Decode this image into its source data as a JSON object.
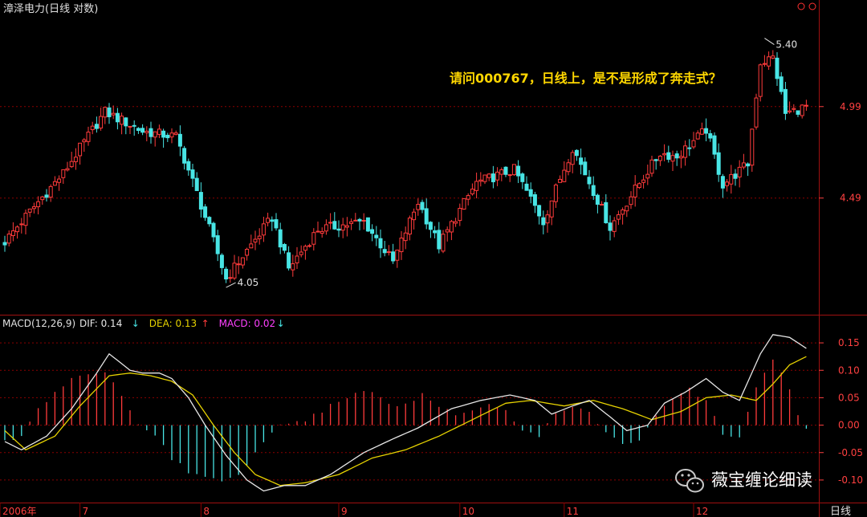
{
  "header": {
    "title": "漳泽电力(日线 对数)",
    "period_label": "日线"
  },
  "annotation": "请问000767，日线上，是不是形成了奔走式？",
  "watermark": {
    "text": "薇宝缠论细读",
    "icon": "wechat-icon"
  },
  "colors": {
    "up": "#ff3b3b",
    "down": "#48e5e5",
    "grid": "#8b0000",
    "axis_text": "#ff4040",
    "dif": "#e6e6e6",
    "dea": "#e6d200",
    "macd": "#ff40ff",
    "annotation": "#ffd700"
  },
  "chart_data": [
    {
      "type": "candlestick",
      "title": "漳泽电力(日线 对数)",
      "scale": "log",
      "y_ticks": [
        "4.99",
        "4.49"
      ],
      "y_tick_values": [
        4.99,
        4.49
      ],
      "ylim": [
        3.95,
        5.55
      ],
      "x_ticks": [
        {
          "label": "2006年",
          "index": 0
        },
        {
          "label": "7",
          "index": 18
        },
        {
          "label": "8",
          "index": 47
        },
        {
          "label": "9",
          "index": 80
        },
        {
          "label": "10",
          "index": 109
        },
        {
          "label": "11",
          "index": 134
        },
        {
          "label": "12",
          "index": 165
        }
      ],
      "annotations": [
        {
          "text": "5.40",
          "value": 5.4,
          "index": 182,
          "kind": "high"
        },
        {
          "text": "4.05",
          "value": 4.05,
          "index": 53,
          "kind": "low"
        }
      ],
      "key_points": [
        {
          "index": 0,
          "value": 4.27
        },
        {
          "index": 14,
          "value": 4.62
        },
        {
          "index": 24,
          "value": 4.96
        },
        {
          "index": 33,
          "value": 4.85
        },
        {
          "index": 41,
          "value": 4.82
        },
        {
          "index": 53,
          "value": 4.09
        },
        {
          "index": 64,
          "value": 4.39
        },
        {
          "index": 68,
          "value": 4.14
        },
        {
          "index": 75,
          "value": 4.33
        },
        {
          "index": 86,
          "value": 4.37
        },
        {
          "index": 93,
          "value": 4.17
        },
        {
          "index": 99,
          "value": 4.47
        },
        {
          "index": 104,
          "value": 4.25
        },
        {
          "index": 113,
          "value": 4.57
        },
        {
          "index": 122,
          "value": 4.64
        },
        {
          "index": 129,
          "value": 4.37
        },
        {
          "index": 136,
          "value": 4.76
        },
        {
          "index": 145,
          "value": 4.34
        },
        {
          "index": 157,
          "value": 4.73
        },
        {
          "index": 161,
          "value": 4.71
        },
        {
          "index": 168,
          "value": 4.86
        },
        {
          "index": 172,
          "value": 4.56
        },
        {
          "index": 178,
          "value": 4.67
        },
        {
          "index": 181,
          "value": 5.25
        },
        {
          "index": 184,
          "value": 5.28
        },
        {
          "index": 187,
          "value": 4.95
        },
        {
          "index": 192,
          "value": 4.99
        }
      ]
    },
    {
      "type": "line",
      "title": "MACD(12,26,9)",
      "legend": [
        {
          "label": "DIF:",
          "value": "0.14",
          "arrow": "↓",
          "color": "#e6e6e6"
        },
        {
          "label": "DEA:",
          "value": "0.13",
          "arrow": "↑",
          "color": "#e6d200"
        },
        {
          "label": "MACD:",
          "value": "0.02",
          "arrow": "↓",
          "color": "#ff40ff"
        }
      ],
      "y_ticks": [
        "0.15",
        "0.10",
        "0.05",
        "0.00",
        "-0.05",
        "-0.10"
      ],
      "y_tick_values": [
        0.15,
        0.1,
        0.05,
        0.0,
        -0.05,
        -0.1
      ],
      "ylim": [
        -0.125,
        0.175
      ],
      "series": [
        {
          "name": "DIF",
          "points": [
            [
              0,
              -0.03
            ],
            [
              4,
              -0.045
            ],
            [
              10,
              -0.02
            ],
            [
              16,
              0.03
            ],
            [
              22,
              0.095
            ],
            [
              25,
              0.13
            ],
            [
              30,
              0.1
            ],
            [
              33,
              0.095
            ],
            [
              37,
              0.095
            ],
            [
              40,
              0.085
            ],
            [
              44,
              0.05
            ],
            [
              48,
              0.0
            ],
            [
              53,
              -0.055
            ],
            [
              58,
              -0.1
            ],
            [
              62,
              -0.12
            ],
            [
              67,
              -0.11
            ],
            [
              72,
              -0.11
            ],
            [
              78,
              -0.09
            ],
            [
              86,
              -0.05
            ],
            [
              93,
              -0.025
            ],
            [
              99,
              -0.005
            ],
            [
              107,
              0.03
            ],
            [
              114,
              0.045
            ],
            [
              121,
              0.055
            ],
            [
              127,
              0.045
            ],
            [
              131,
              0.02
            ],
            [
              136,
              0.035
            ],
            [
              140,
              0.045
            ],
            [
              145,
              0.015
            ],
            [
              149,
              -0.01
            ],
            [
              154,
              0.0
            ],
            [
              158,
              0.04
            ],
            [
              163,
              0.06
            ],
            [
              168,
              0.085
            ],
            [
              172,
              0.06
            ],
            [
              176,
              0.045
            ],
            [
              181,
              0.13
            ],
            [
              184,
              0.165
            ],
            [
              188,
              0.16
            ],
            [
              192,
              0.14
            ]
          ]
        },
        {
          "name": "DEA",
          "points": [
            [
              0,
              -0.01
            ],
            [
              5,
              -0.045
            ],
            [
              12,
              -0.02
            ],
            [
              18,
              0.035
            ],
            [
              25,
              0.09
            ],
            [
              30,
              0.095
            ],
            [
              35,
              0.09
            ],
            [
              40,
              0.08
            ],
            [
              45,
              0.055
            ],
            [
              50,
              0.0
            ],
            [
              55,
              -0.05
            ],
            [
              60,
              -0.09
            ],
            [
              66,
              -0.11
            ],
            [
              72,
              -0.105
            ],
            [
              80,
              -0.09
            ],
            [
              88,
              -0.06
            ],
            [
              96,
              -0.045
            ],
            [
              104,
              -0.02
            ],
            [
              112,
              0.01
            ],
            [
              120,
              0.04
            ],
            [
              126,
              0.045
            ],
            [
              134,
              0.035
            ],
            [
              141,
              0.045
            ],
            [
              148,
              0.03
            ],
            [
              155,
              0.01
            ],
            [
              162,
              0.025
            ],
            [
              168,
              0.05
            ],
            [
              174,
              0.055
            ],
            [
              180,
              0.045
            ],
            [
              184,
              0.075
            ],
            [
              188,
              0.11
            ],
            [
              192,
              0.125
            ]
          ]
        },
        {
          "name": "MACD",
          "type": "histogram",
          "points": [
            [
              0,
              -0.03
            ],
            [
              4,
              -0.02
            ],
            [
              8,
              0.03
            ],
            [
              12,
              0.06
            ],
            [
              16,
              0.085
            ],
            [
              20,
              0.09
            ],
            [
              24,
              0.1
            ],
            [
              28,
              0.05
            ],
            [
              32,
              0.0
            ],
            [
              36,
              -0.02
            ],
            [
              40,
              -0.06
            ],
            [
              44,
              -0.085
            ],
            [
              48,
              -0.095
            ],
            [
              52,
              -0.1
            ],
            [
              56,
              -0.09
            ],
            [
              60,
              -0.05
            ],
            [
              64,
              -0.01
            ],
            [
              68,
              0.005
            ],
            [
              72,
              0.01
            ],
            [
              76,
              0.025
            ],
            [
              80,
              0.045
            ],
            [
              84,
              0.06
            ],
            [
              88,
              0.06
            ],
            [
              92,
              0.035
            ],
            [
              96,
              0.04
            ],
            [
              100,
              0.055
            ],
            [
              104,
              0.035
            ],
            [
              108,
              0.02
            ],
            [
              112,
              0.025
            ],
            [
              116,
              0.035
            ],
            [
              120,
              0.025
            ],
            [
              124,
              -0.01
            ],
            [
              128,
              -0.02
            ],
            [
              132,
              0.025
            ],
            [
              136,
              0.035
            ],
            [
              140,
              0.025
            ],
            [
              144,
              -0.015
            ],
            [
              148,
              -0.035
            ],
            [
              152,
              -0.03
            ],
            [
              156,
              0.02
            ],
            [
              160,
              0.05
            ],
            [
              164,
              0.065
            ],
            [
              168,
              0.045
            ],
            [
              172,
              -0.015
            ],
            [
              176,
              -0.02
            ],
            [
              180,
              0.07
            ],
            [
              184,
              0.12
            ],
            [
              187,
              0.085
            ],
            [
              190,
              0.02
            ],
            [
              192,
              -0.005
            ]
          ]
        }
      ]
    }
  ]
}
